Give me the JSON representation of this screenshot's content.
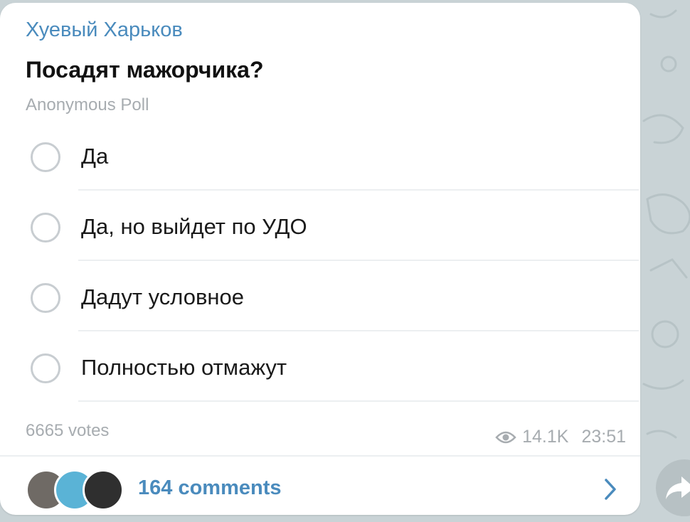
{
  "channel": {
    "name": "Хуевый Харьков"
  },
  "poll": {
    "question": "Посадят мажорчика?",
    "type": "Anonymous Poll",
    "options": [
      {
        "label": "Да"
      },
      {
        "label": "Да, но выйдет по УДО"
      },
      {
        "label": "Дадут условное"
      },
      {
        "label": "Полностью отмажут"
      }
    ],
    "votes": "6665 votes"
  },
  "message": {
    "views": "14.1K",
    "time": "23:51"
  },
  "comments": {
    "label": "164 comments"
  },
  "colors": {
    "accent": "#4a8bbd",
    "muted": "#a7acb0",
    "radio": "#c8cdd1",
    "background": "#c9d3d6"
  },
  "icons": {
    "views": "eye-icon",
    "comments_arrow": "chevron-right-icon",
    "share": "share-arrow-icon"
  }
}
